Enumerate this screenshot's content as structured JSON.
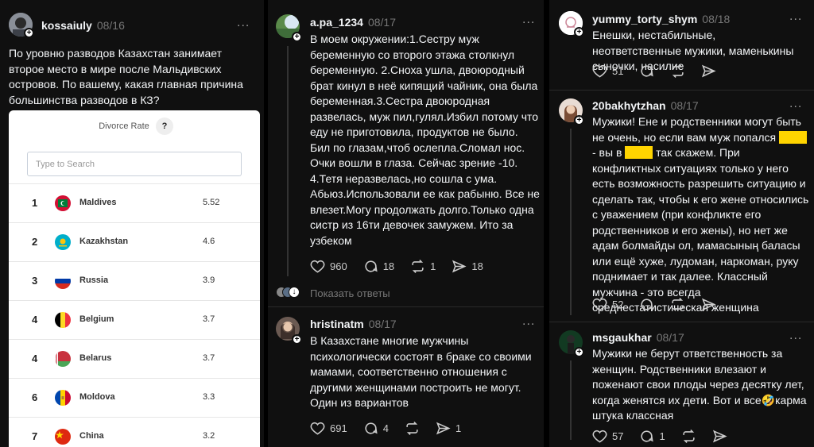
{
  "col1": {
    "post": {
      "username": "kossaiuly",
      "date": "08/16",
      "more": "...",
      "text": "По уровню разводов Казахстан занимает второе место в мире после Мальдивских островов. По вашему, какая главная причина большинства разводов в КЗ?"
    },
    "card": {
      "title": "Divorce Rate",
      "help": "?",
      "search_placeholder": "Type to Search",
      "rows": [
        {
          "rank": "1",
          "country": "Maldives",
          "value": "5.52"
        },
        {
          "rank": "2",
          "country": "Kazakhstan",
          "value": "4.6"
        },
        {
          "rank": "3",
          "country": "Russia",
          "value": "3.9"
        },
        {
          "rank": "4",
          "country": "Belgium",
          "value": "3.7"
        },
        {
          "rank": "4",
          "country": "Belarus",
          "value": "3.7"
        },
        {
          "rank": "6",
          "country": "Moldova",
          "value": "3.3"
        },
        {
          "rank": "7",
          "country": "China",
          "value": "3.2"
        }
      ]
    }
  },
  "col2": {
    "post1": {
      "username": "a.pa_1234",
      "date": "08/17",
      "more": "...",
      "text": "В моем окружении:1.Сестру муж беременную со второго этажа столкнул беременную. 2.Сноха ушла, двоюродный брат кинул в неё кипящий чайник, она была беременная.3.Сестра двоюродная развелась, муж пил,гулял.Избил потому что еду не приготовила, продуктов не было. Бил по глазам,чтоб ослепла.Сломал нос. Очки вошли в глаза. Сейчас зрение -10. 4.Тетя неразвелась,но сошла с ума. Абьюз.Использовали ее как рабыню. Все не влезет.Могу продолжать долго.Только одна систр из 16ти девочек замужем. Ито за узбеком",
      "likes": "960",
      "comments": "18",
      "reposts": "1",
      "shares": "18"
    },
    "show_replies": "Показать ответы",
    "post2": {
      "username": "hristinatm",
      "date": "08/17",
      "more": "...",
      "text": "В Казахстане многие мужчины психологически состоят в браке со своими мамами, соответственно отношения с другими женщинами построить не могут. Один из вариантов",
      "likes": "691",
      "comments": "4",
      "shares": "1"
    }
  },
  "col3": {
    "post1": {
      "username": "yummy_torty_shym",
      "date": "08/18",
      "more": "...",
      "text": "Енешки, нестабильные, неответственные мужики, маменькины сыночки, насилие",
      "likes": "51"
    },
    "post2": {
      "username": "20bakhytzhan",
      "date": "08/17",
      "more": "...",
      "text_a": "Мужики! Ене и родственники могут быть не очень, но если вам муж попался ",
      "redact1": "xxxxx",
      "text_b": " - вы в ",
      "redact2": "xxxxx",
      "text_c": " так скажем. При конфликтных ситуациях только у него есть возможность разрешить ситуацию и сделать так, чтобы к его жене относились с уважением (при конфликте его родственников и его жены), но нет же адам болмайды ол, мамасының баласы или ещё хуже, лудоман, наркоман, руку поднимает и так далее. Классный мужчина - это всегда среднестатистическая женщина",
      "likes": "52"
    },
    "post3": {
      "username": "msgaukhar",
      "date": "08/17",
      "more": "...",
      "text": "Мужики не берут ответственность за женщин. Родственники влезают и поженают свои плоды через десятку лет, когда женятся их дети. Вот и все🤣карма штука классная",
      "likes": "57",
      "comments": "1"
    }
  },
  "colors": {
    "background": "#101010",
    "text": "#f3f5f7",
    "muted": "#777777",
    "redaction": "#ffd400"
  }
}
